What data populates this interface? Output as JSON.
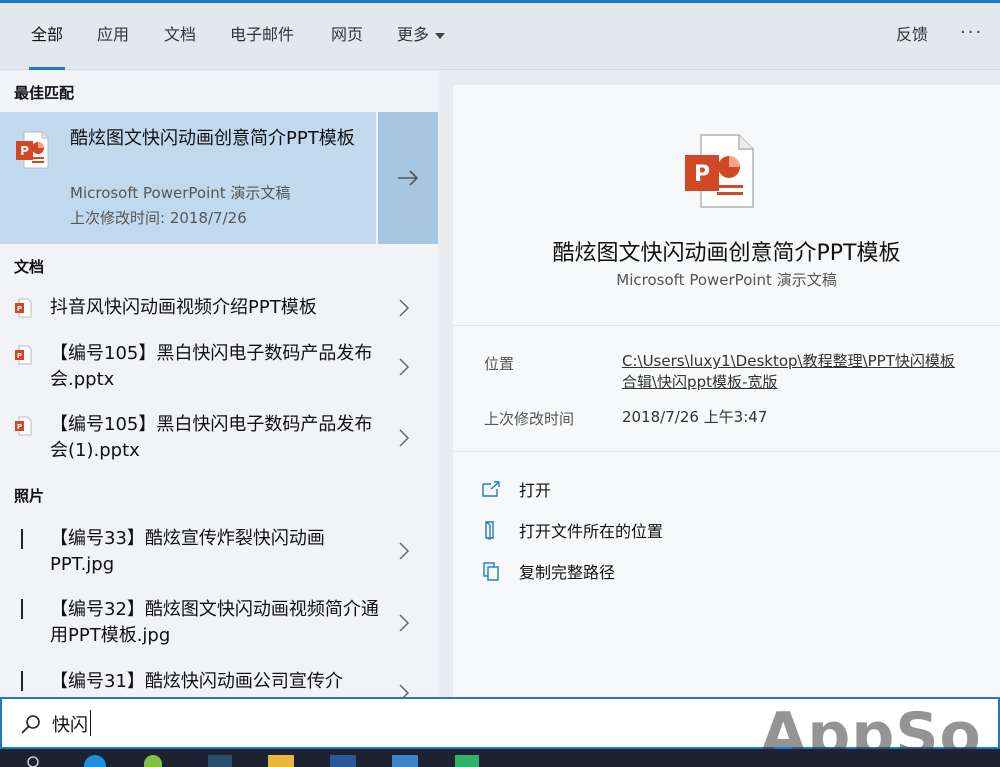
{
  "tabs": [
    {
      "label": "全部"
    },
    {
      "label": "应用"
    },
    {
      "label": "文档"
    },
    {
      "label": "电子邮件"
    },
    {
      "label": "网页"
    },
    {
      "label": "更多"
    }
  ],
  "header": {
    "feedback_label": "反馈",
    "more_dots": "···"
  },
  "best_match": {
    "section_title": "最佳匹配",
    "title": "酷炫图文快闪动画创意简介PPT模板",
    "type": "Microsoft PowerPoint 演示文稿",
    "modified": "上次修改时间: 2018/7/26"
  },
  "documents": {
    "section_title": "文档",
    "items": [
      {
        "text": "抖音风快闪动画视频介绍PPT模板"
      },
      {
        "text": "【编号105】黑白快闪电子数码产品发布会.pptx"
      },
      {
        "text": "【编号105】黑白快闪电子数码产品发布会(1).pptx"
      }
    ]
  },
  "photos": {
    "section_title": "照片",
    "items": [
      {
        "text": "【编号33】酷炫宣传炸裂快闪动画PPT.jpg"
      },
      {
        "text": "【编号32】酷炫图文快闪动画视频简介通用PPT模板.jpg"
      },
      {
        "text": "【编号31】酷炫快闪动画公司宣传介"
      }
    ]
  },
  "preview": {
    "title": "酷炫图文快闪动画创意简介PPT模板",
    "type": "Microsoft PowerPoint 演示文稿",
    "location_label": "位置",
    "location_value": "C:\\Users\\luxy1\\Desktop\\教程整理\\PPT快闪模板合辑\\快闪ppt模板-宽版",
    "modified_label": "上次修改时间",
    "modified_value": "2018/7/26 上午3:47",
    "actions": [
      {
        "label": "打开",
        "icon": "open-icon"
      },
      {
        "label": "打开文件所在的位置",
        "icon": "folder-location-icon"
      },
      {
        "label": "复制完整路径",
        "icon": "copy-icon"
      }
    ]
  },
  "search": {
    "query": "快闪"
  },
  "watermark": "AppSo",
  "colors": {
    "accent": "#1f7ac4",
    "selected": "#c1d9ef",
    "ppt_orange": "#d24726"
  }
}
